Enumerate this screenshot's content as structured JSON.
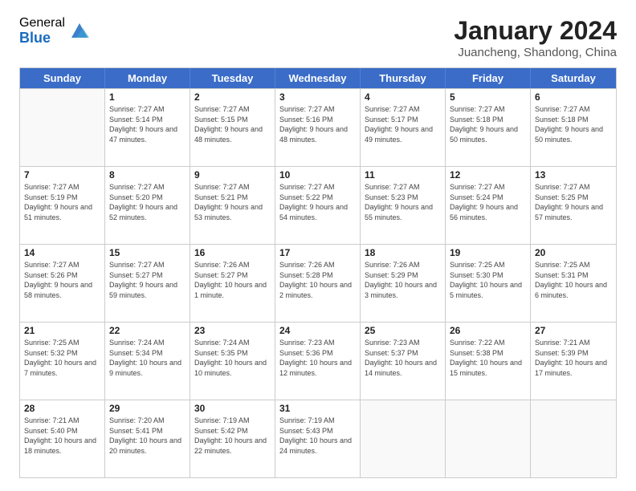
{
  "header": {
    "logo_general": "General",
    "logo_blue": "Blue",
    "month_title": "January 2024",
    "location": "Juancheng, Shandong, China"
  },
  "weekdays": [
    "Sunday",
    "Monday",
    "Tuesday",
    "Wednesday",
    "Thursday",
    "Friday",
    "Saturday"
  ],
  "weeks": [
    [
      {
        "day": "",
        "sunrise": "",
        "sunset": "",
        "daylight": "",
        "empty": true
      },
      {
        "day": "1",
        "sunrise": "Sunrise: 7:27 AM",
        "sunset": "Sunset: 5:14 PM",
        "daylight": "Daylight: 9 hours and 47 minutes."
      },
      {
        "day": "2",
        "sunrise": "Sunrise: 7:27 AM",
        "sunset": "Sunset: 5:15 PM",
        "daylight": "Daylight: 9 hours and 48 minutes."
      },
      {
        "day": "3",
        "sunrise": "Sunrise: 7:27 AM",
        "sunset": "Sunset: 5:16 PM",
        "daylight": "Daylight: 9 hours and 48 minutes."
      },
      {
        "day": "4",
        "sunrise": "Sunrise: 7:27 AM",
        "sunset": "Sunset: 5:17 PM",
        "daylight": "Daylight: 9 hours and 49 minutes."
      },
      {
        "day": "5",
        "sunrise": "Sunrise: 7:27 AM",
        "sunset": "Sunset: 5:18 PM",
        "daylight": "Daylight: 9 hours and 50 minutes."
      },
      {
        "day": "6",
        "sunrise": "Sunrise: 7:27 AM",
        "sunset": "Sunset: 5:18 PM",
        "daylight": "Daylight: 9 hours and 50 minutes."
      }
    ],
    [
      {
        "day": "7",
        "sunrise": "Sunrise: 7:27 AM",
        "sunset": "Sunset: 5:19 PM",
        "daylight": "Daylight: 9 hours and 51 minutes."
      },
      {
        "day": "8",
        "sunrise": "Sunrise: 7:27 AM",
        "sunset": "Sunset: 5:20 PM",
        "daylight": "Daylight: 9 hours and 52 minutes."
      },
      {
        "day": "9",
        "sunrise": "Sunrise: 7:27 AM",
        "sunset": "Sunset: 5:21 PM",
        "daylight": "Daylight: 9 hours and 53 minutes."
      },
      {
        "day": "10",
        "sunrise": "Sunrise: 7:27 AM",
        "sunset": "Sunset: 5:22 PM",
        "daylight": "Daylight: 9 hours and 54 minutes."
      },
      {
        "day": "11",
        "sunrise": "Sunrise: 7:27 AM",
        "sunset": "Sunset: 5:23 PM",
        "daylight": "Daylight: 9 hours and 55 minutes."
      },
      {
        "day": "12",
        "sunrise": "Sunrise: 7:27 AM",
        "sunset": "Sunset: 5:24 PM",
        "daylight": "Daylight: 9 hours and 56 minutes."
      },
      {
        "day": "13",
        "sunrise": "Sunrise: 7:27 AM",
        "sunset": "Sunset: 5:25 PM",
        "daylight": "Daylight: 9 hours and 57 minutes."
      }
    ],
    [
      {
        "day": "14",
        "sunrise": "Sunrise: 7:27 AM",
        "sunset": "Sunset: 5:26 PM",
        "daylight": "Daylight: 9 hours and 58 minutes."
      },
      {
        "day": "15",
        "sunrise": "Sunrise: 7:27 AM",
        "sunset": "Sunset: 5:27 PM",
        "daylight": "Daylight: 9 hours and 59 minutes."
      },
      {
        "day": "16",
        "sunrise": "Sunrise: 7:26 AM",
        "sunset": "Sunset: 5:27 PM",
        "daylight": "Daylight: 10 hours and 1 minute."
      },
      {
        "day": "17",
        "sunrise": "Sunrise: 7:26 AM",
        "sunset": "Sunset: 5:28 PM",
        "daylight": "Daylight: 10 hours and 2 minutes."
      },
      {
        "day": "18",
        "sunrise": "Sunrise: 7:26 AM",
        "sunset": "Sunset: 5:29 PM",
        "daylight": "Daylight: 10 hours and 3 minutes."
      },
      {
        "day": "19",
        "sunrise": "Sunrise: 7:25 AM",
        "sunset": "Sunset: 5:30 PM",
        "daylight": "Daylight: 10 hours and 5 minutes."
      },
      {
        "day": "20",
        "sunrise": "Sunrise: 7:25 AM",
        "sunset": "Sunset: 5:31 PM",
        "daylight": "Daylight: 10 hours and 6 minutes."
      }
    ],
    [
      {
        "day": "21",
        "sunrise": "Sunrise: 7:25 AM",
        "sunset": "Sunset: 5:32 PM",
        "daylight": "Daylight: 10 hours and 7 minutes."
      },
      {
        "day": "22",
        "sunrise": "Sunrise: 7:24 AM",
        "sunset": "Sunset: 5:34 PM",
        "daylight": "Daylight: 10 hours and 9 minutes."
      },
      {
        "day": "23",
        "sunrise": "Sunrise: 7:24 AM",
        "sunset": "Sunset: 5:35 PM",
        "daylight": "Daylight: 10 hours and 10 minutes."
      },
      {
        "day": "24",
        "sunrise": "Sunrise: 7:23 AM",
        "sunset": "Sunset: 5:36 PM",
        "daylight": "Daylight: 10 hours and 12 minutes."
      },
      {
        "day": "25",
        "sunrise": "Sunrise: 7:23 AM",
        "sunset": "Sunset: 5:37 PM",
        "daylight": "Daylight: 10 hours and 14 minutes."
      },
      {
        "day": "26",
        "sunrise": "Sunrise: 7:22 AM",
        "sunset": "Sunset: 5:38 PM",
        "daylight": "Daylight: 10 hours and 15 minutes."
      },
      {
        "day": "27",
        "sunrise": "Sunrise: 7:21 AM",
        "sunset": "Sunset: 5:39 PM",
        "daylight": "Daylight: 10 hours and 17 minutes."
      }
    ],
    [
      {
        "day": "28",
        "sunrise": "Sunrise: 7:21 AM",
        "sunset": "Sunset: 5:40 PM",
        "daylight": "Daylight: 10 hours and 18 minutes."
      },
      {
        "day": "29",
        "sunrise": "Sunrise: 7:20 AM",
        "sunset": "Sunset: 5:41 PM",
        "daylight": "Daylight: 10 hours and 20 minutes."
      },
      {
        "day": "30",
        "sunrise": "Sunrise: 7:19 AM",
        "sunset": "Sunset: 5:42 PM",
        "daylight": "Daylight: 10 hours and 22 minutes."
      },
      {
        "day": "31",
        "sunrise": "Sunrise: 7:19 AM",
        "sunset": "Sunset: 5:43 PM",
        "daylight": "Daylight: 10 hours and 24 minutes."
      },
      {
        "day": "",
        "sunrise": "",
        "sunset": "",
        "daylight": "",
        "empty": true
      },
      {
        "day": "",
        "sunrise": "",
        "sunset": "",
        "daylight": "",
        "empty": true
      },
      {
        "day": "",
        "sunrise": "",
        "sunset": "",
        "daylight": "",
        "empty": true
      }
    ]
  ]
}
